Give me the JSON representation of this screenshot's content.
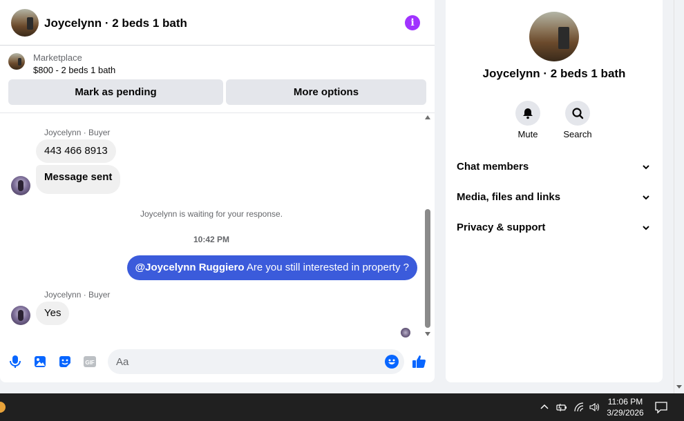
{
  "header": {
    "title": "Joycelynn · 2 beds 1 bath",
    "info_icon": "info-icon"
  },
  "listing": {
    "source": "Marketplace",
    "price_title": "$800 - 2 beds 1 bath",
    "mark_pending": "Mark as pending",
    "more_options": "More options"
  },
  "messages": {
    "sender_1": "Joycelynn · Buyer",
    "bubble_phone": "443 466 8913",
    "bubble_sent": "Message sent",
    "status": "Joycelynn is waiting for your response.",
    "time": "10:42 PM",
    "outgoing_mention": "@Joycelynn Ruggiero",
    "outgoing_text": " Are you still interested in property ?",
    "sender_2": "Joycelynn · Buyer",
    "reply": "Yes"
  },
  "composer": {
    "placeholder": "Aa",
    "value": ""
  },
  "info_panel": {
    "title": "Joycelynn · 2 beds 1 bath",
    "actions": [
      {
        "label": "Mute",
        "icon": "bell-icon"
      },
      {
        "label": "Search",
        "icon": "search-icon"
      }
    ],
    "sections": [
      {
        "label": "Chat members"
      },
      {
        "label": "Media, files and links"
      },
      {
        "label": "Privacy & support"
      }
    ]
  },
  "taskbar": {
    "time": "11:06 PM",
    "date": "3/29/2026"
  },
  "colors": {
    "accent": "#0866ff",
    "outgoing_bubble": "#3b5bdb",
    "info_icon": "#a033ff",
    "taskbar": "#202020"
  }
}
